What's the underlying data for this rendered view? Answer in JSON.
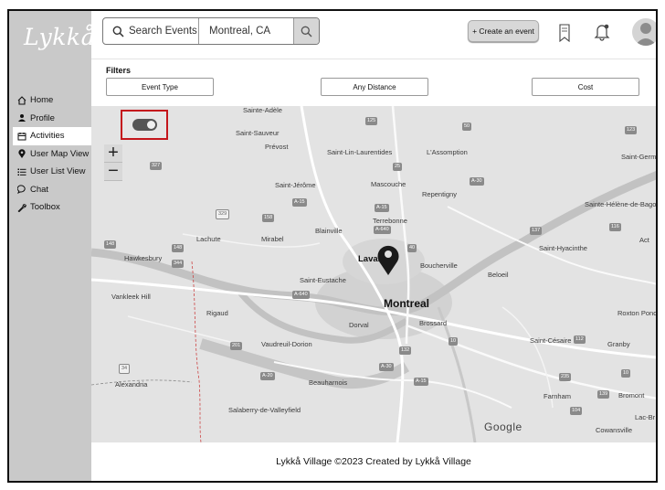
{
  "app": {
    "logo": "Lykkå"
  },
  "sidebar": {
    "items": [
      {
        "label": "Home",
        "icon": "home-icon",
        "glyph": "⌂"
      },
      {
        "label": "Profile",
        "icon": "person-icon",
        "glyph": "👤"
      },
      {
        "label": "Activities",
        "icon": "calendar-icon",
        "glyph": "▦"
      },
      {
        "label": "User Map View",
        "icon": "map-pin-icon",
        "glyph": "●"
      },
      {
        "label": "User List View",
        "icon": "list-icon",
        "glyph": "☰"
      },
      {
        "label": "Chat",
        "icon": "chat-bubble-icon",
        "glyph": "○"
      },
      {
        "label": "Toolbox",
        "icon": "wrench-icon",
        "glyph": "⚒"
      }
    ],
    "active_index": 2
  },
  "header": {
    "search_placeholder": "Search Events",
    "location_value": "Montreal, CA",
    "create_label": "+ Create an event"
  },
  "filters": {
    "title": "Filters",
    "event_type": "Event Type",
    "distance": "Any Distance",
    "cost": "Cost"
  },
  "map": {
    "places": {
      "sainte_adele": "Sainte-Adèle",
      "saint_sauveur": "Saint-Sauveur",
      "prevost": "Prévost",
      "saint_lin": "Saint-Lin-Laurentides",
      "lassomption": "L'Assomption",
      "saint_germain": "Saint-Germ",
      "saint_jerome": "Saint-Jérôme",
      "mascouche": "Mascouche",
      "repentigny": "Repentigny",
      "sainte_helene": "Sainte-Hélène-de-Bagot",
      "terrebonne": "Terrebonne",
      "blainville": "Blainville",
      "lachute": "Lachute",
      "mirabel": "Mirabel",
      "act": "Act",
      "saint_hyacinthe": "Saint-Hyacinthe",
      "hawkesbury": "Hawkesbury",
      "laval": "Laval",
      "boucherville": "Boucherville",
      "beloeil": "Beloeil",
      "saint_eustache": "Saint-Eustache",
      "vankleek": "Vankleek Hill",
      "montreal": "Montreal",
      "rigaud": "Rigaud",
      "dorval": "Dorval",
      "brossard": "Brossard",
      "roxton": "Roxton Pond",
      "vaudreuil": "Vaudreuil-Dorion",
      "saint_cesaire": "Saint-Césaire",
      "granby": "Granby",
      "alexandria": "Alexandria",
      "beauharnois": "Beauharnois",
      "farnham": "Farnham",
      "bromont": "Bromont",
      "salaberry": "Salaberry-de-Valleyfield",
      "lac_brome": "Lac-Br",
      "cowansville": "Cowansville"
    },
    "shields": {
      "s125": "125",
      "s50": "50",
      "s123": "123",
      "s327": "327",
      "s25": "25",
      "a30": "A-30",
      "a15": "A-15",
      "s329": "329",
      "s158": "158",
      "a640": "A-640",
      "s148": "148",
      "s344": "344",
      "s40": "40",
      "s137": "137",
      "s116": "116",
      "s201": "201",
      "s132": "132",
      "s20": "20",
      "s34": "34",
      "a20": "A-20",
      "s235": "235",
      "s10": "10",
      "s139": "139",
      "s104": "104",
      "s112": "112"
    },
    "zoom_in": "+",
    "zoom_out": "−",
    "attribution": "Google",
    "toggle_on": true
  },
  "footer": {
    "text": "Lykkå Village ©2023 Created by Lykkå Village"
  }
}
